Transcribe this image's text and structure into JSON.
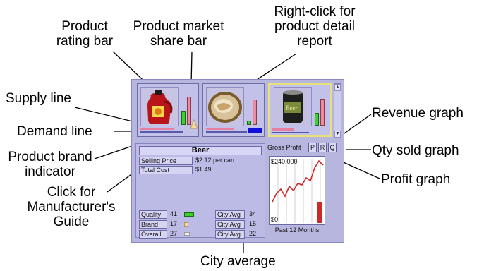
{
  "callouts": {
    "product_rating_bar": [
      "Product",
      "rating bar"
    ],
    "market_share_bar": [
      "Product market",
      "share bar"
    ],
    "right_click": [
      "Right-click for",
      "product detail",
      "report"
    ],
    "supply_line": "Supply line",
    "demand_line": "Demand line",
    "brand_indicator": [
      "Product brand",
      "indicator"
    ],
    "manufacturers_guide": [
      "Click for",
      "Manufacturer's",
      "Guide"
    ],
    "revenue_graph": "Revenue graph",
    "qty_sold_graph": "Qty sold graph",
    "profit_graph": "Profit graph",
    "city_average": "City average"
  },
  "product": {
    "name": "Beer",
    "selling_price_label": "Selling Price",
    "selling_price_value": "$2.12 per can",
    "total_cost_label": "Total Cost",
    "total_cost_value": "$1.49"
  },
  "ratings": [
    {
      "label": "Quality",
      "value": "41",
      "avg_label": "City Avg",
      "avg": "34"
    },
    {
      "label": "Brand",
      "value": "17",
      "avg_label": "City Avg",
      "avg": "15"
    },
    {
      "label": "Overall",
      "value": "27",
      "avg_label": "City Avg",
      "avg": "22"
    }
  ],
  "graph": {
    "title": "Gross Profit",
    "buttons": [
      "P",
      "R",
      "Q"
    ],
    "y_max_label": "$240,000",
    "y_min_label": "$0",
    "period_label": "Past 12 Months"
  },
  "colors": {
    "panel_bg": "#b7b6df",
    "line": "#cc2a2a",
    "rating_green": "#3bd12b",
    "accent_pink": "#f08aa0"
  }
}
